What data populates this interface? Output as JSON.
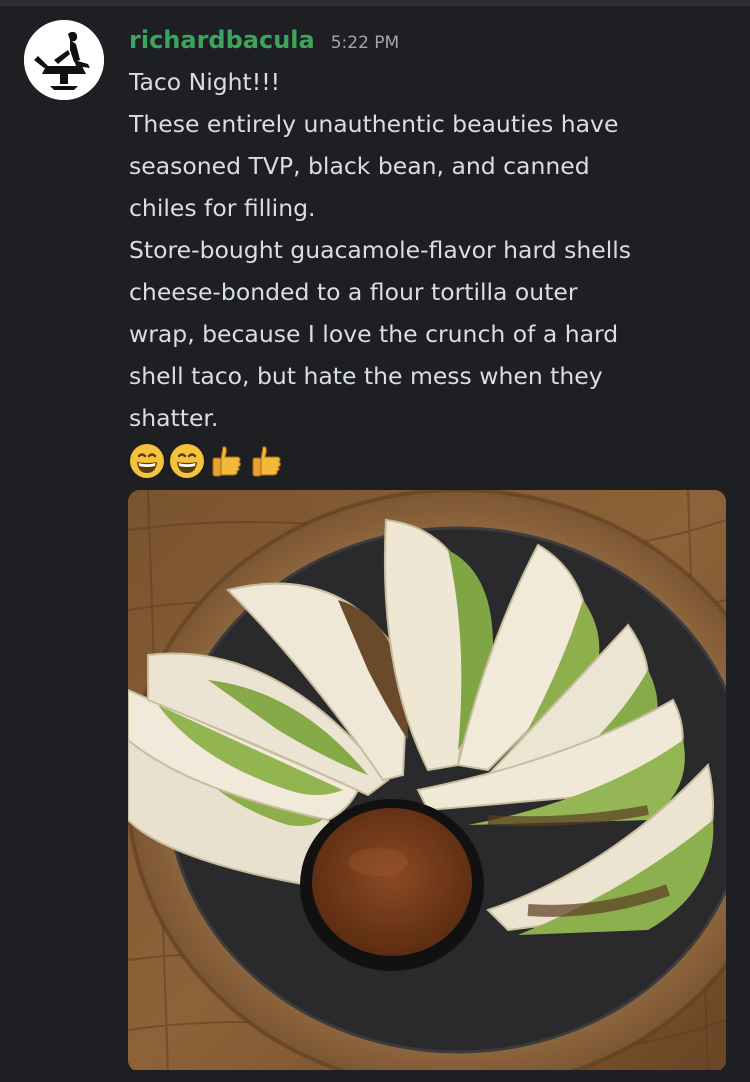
{
  "message": {
    "username": "richardbacula",
    "timestamp": "5:22 PM",
    "lines": [
      "Taco Night!!!",
      "These entirely unauthentic beauties have",
      "seasoned TVP, black bean, and canned",
      "chiles for filling.",
      "Store-bought guacamole-flavor hard shells",
      "cheese-bonded to a flour tortilla outer",
      "wrap, because I love the crunch of a hard",
      "shell taco, but hate the mess when they",
      "shatter."
    ],
    "emojis": [
      "grinning-face",
      "grinning-face",
      "thumbs-up",
      "thumbs-up"
    ]
  },
  "colors": {
    "background": "#1e1f22",
    "username": "#3ba55d",
    "text": "#dbdee1",
    "timestamp": "#a3a6aa"
  }
}
